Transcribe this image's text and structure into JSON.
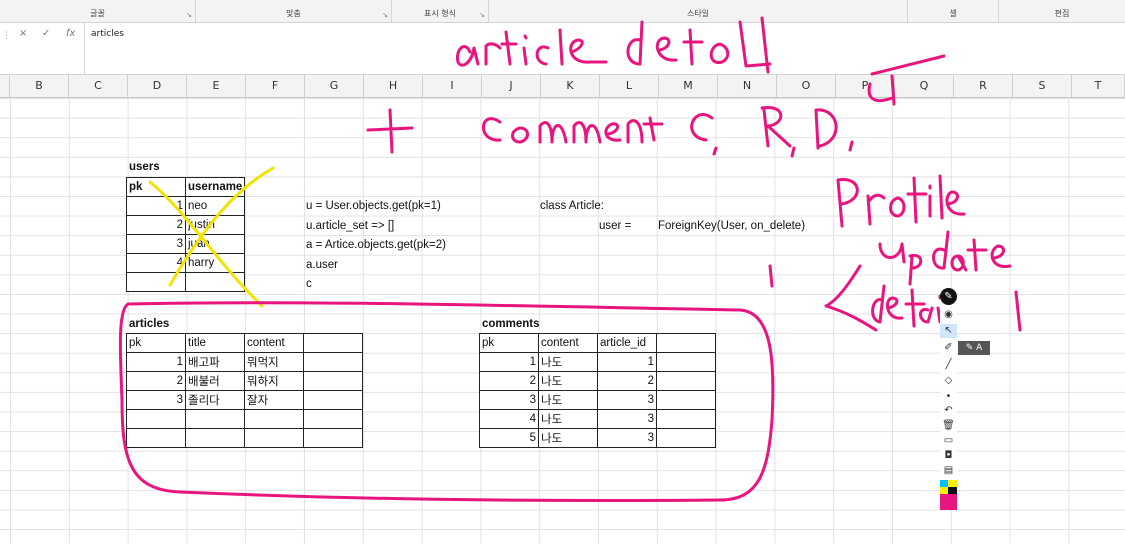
{
  "ribbon": {
    "groups": [
      "글꼴",
      "맞춤",
      "표시 형식",
      "스타일",
      "셀",
      "편집"
    ]
  },
  "formula_bar": {
    "cancel": "×",
    "enter": "✓",
    "fx": "fx",
    "content": "articles"
  },
  "columns": [
    "B",
    "C",
    "D",
    "E",
    "F",
    "G",
    "H",
    "I",
    "J",
    "K",
    "L",
    "M",
    "N",
    "O",
    "P",
    "Q",
    "R",
    "S",
    "T"
  ],
  "users": {
    "title": "users",
    "headers": [
      "pk",
      "username"
    ],
    "rows": [
      [
        "1",
        "neo"
      ],
      [
        "2",
        "justin"
      ],
      [
        "3",
        "juan"
      ],
      [
        "4",
        "harry"
      ],
      [
        "",
        ""
      ]
    ]
  },
  "code": {
    "lines": [
      "u = User.objects.get(pk=1)",
      "u.article_set => []",
      "a = Artice.objects.get(pk=2)",
      "a.user",
      "c"
    ],
    "class_line": "class Article:",
    "field_name": "user =",
    "field_value": "ForeignKey(User, on_delete)"
  },
  "articles": {
    "title": "articles",
    "headers": [
      "pk",
      "title",
      "content",
      ""
    ],
    "rows": [
      [
        "1",
        "배고파",
        "뭐먹지",
        ""
      ],
      [
        "2",
        "배불러",
        "뭐하지",
        ""
      ],
      [
        "3",
        "졸리다",
        "잘자",
        ""
      ],
      [
        "",
        "",
        "",
        ""
      ],
      [
        "",
        "",
        "",
        ""
      ]
    ]
  },
  "comments": {
    "title": "comments",
    "headers": [
      "pk",
      "content",
      "article_id",
      ""
    ],
    "rows": [
      [
        "1",
        "나도",
        "1",
        ""
      ],
      [
        "2",
        "나도",
        "2",
        ""
      ],
      [
        "3",
        "나도",
        "3",
        ""
      ],
      [
        "4",
        "나도",
        "3",
        ""
      ],
      [
        "5",
        "나도",
        "3",
        ""
      ]
    ]
  },
  "annotations": {
    "pink": "#e8157f",
    "yellow": "#f2e300",
    "line1": "article detail",
    "line2": "+ comment C, R, D, U",
    "line3": "Profile update detail"
  },
  "pen_toolbar": {
    "tooltip": "A",
    "icons": [
      "pen-icon",
      "eye-icon",
      "pointer-icon",
      "highlighter-icon",
      "marker-icon",
      "eraser-icon",
      "dot-icon",
      "undo-icon",
      "trash-icon",
      "screen-icon",
      "camera-icon",
      "clipboard-icon",
      "palette-icon"
    ]
  }
}
